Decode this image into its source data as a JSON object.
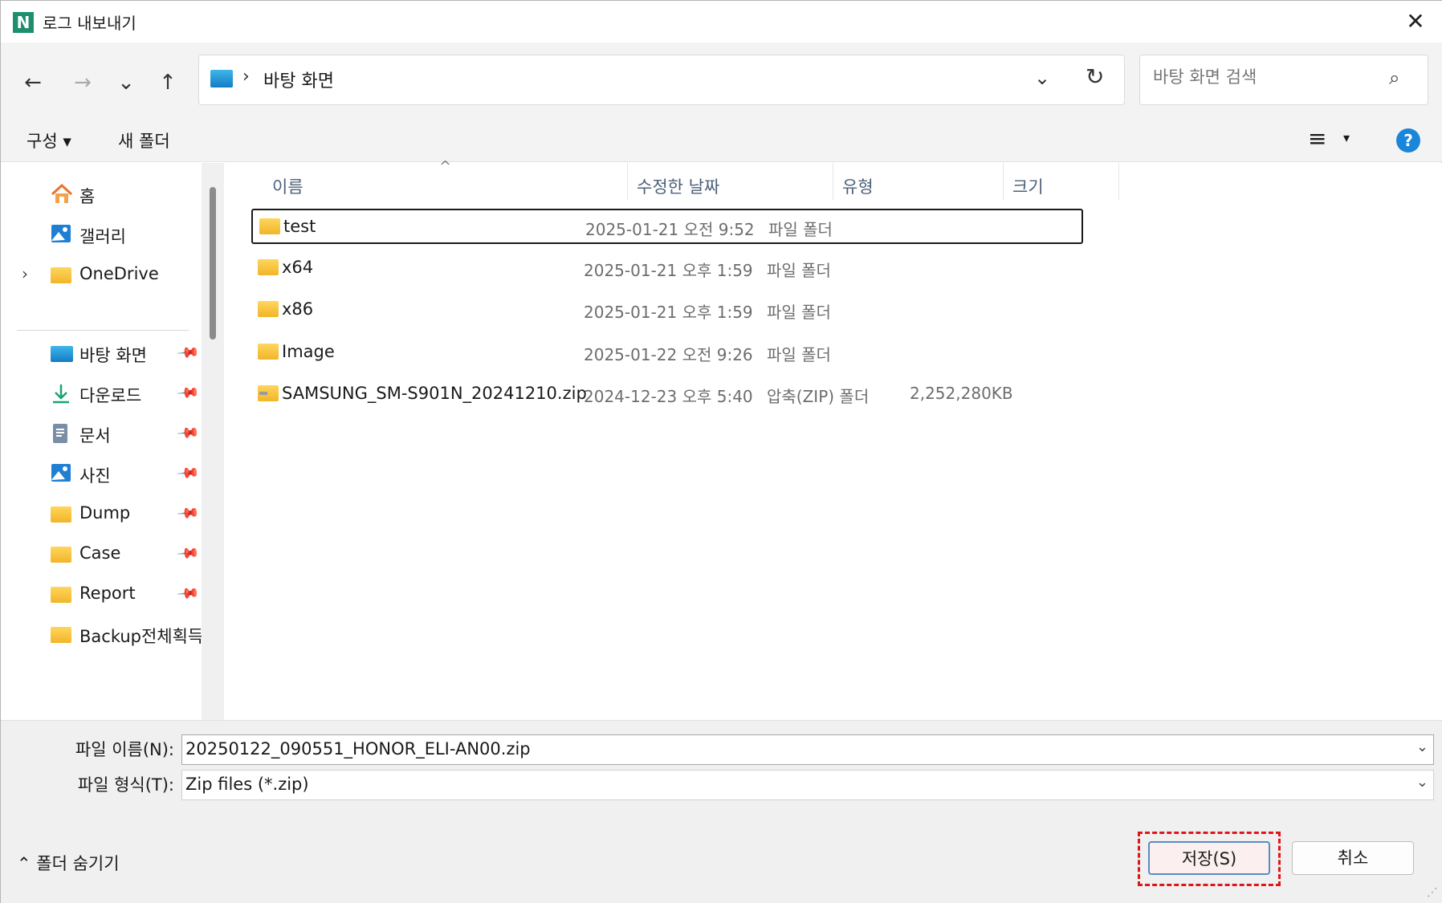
{
  "titlebar": {
    "app_icon_letter": "N",
    "title": "로그 내보내기",
    "close_glyph": "✕"
  },
  "nav": {
    "back_glyph": "←",
    "forward_glyph": "→",
    "recent_glyph": "⌄",
    "up_glyph": "↑",
    "address_separator": "›",
    "address_path": "바탕 화면",
    "address_dropdown_glyph": "⌄",
    "refresh_glyph": "↻",
    "search_placeholder": "바탕 화면 검색",
    "search_glyph": "⌕"
  },
  "commandbar": {
    "organize_label": "구성 ▾",
    "new_folder_label": "새 폴더",
    "view_glyph": "≡",
    "view_dropdown_glyph": "▾",
    "help_glyph": "?"
  },
  "sidebar": {
    "expander_glyph": "›",
    "pin_glyph": "📌",
    "top_items": [
      {
        "label": "홈",
        "icon": "home-icon"
      },
      {
        "label": "갤러리",
        "icon": "gallery-icon"
      },
      {
        "label": "OneDrive",
        "icon": "folder-icon"
      }
    ],
    "quick_items": [
      {
        "label": "바탕 화면",
        "icon": "desktop-icon",
        "pinned": true
      },
      {
        "label": "다운로드",
        "icon": "download-icon",
        "pinned": true
      },
      {
        "label": "문서",
        "icon": "document-icon",
        "pinned": true
      },
      {
        "label": "사진",
        "icon": "pictures-icon",
        "pinned": true
      },
      {
        "label": "Dump",
        "icon": "folder-icon",
        "pinned": true
      },
      {
        "label": "Case",
        "icon": "folder-icon",
        "pinned": true
      },
      {
        "label": "Report",
        "icon": "folder-icon",
        "pinned": true
      },
      {
        "label": "Backup전체획득",
        "icon": "folder-icon",
        "pinned": false
      }
    ]
  },
  "filelist": {
    "sort_glyph": "^",
    "columns": {
      "name": "이름",
      "date": "수정한 날짜",
      "type": "유형",
      "size": "크기"
    },
    "rows": [
      {
        "name": "test",
        "date": "2025-01-21 오전 9:52",
        "type": "파일 폴더",
        "size": "",
        "icon": "folder-icon",
        "selected": true
      },
      {
        "name": "x64",
        "date": "2025-01-21 오후 1:59",
        "type": "파일 폴더",
        "size": "",
        "icon": "folder-icon",
        "selected": false
      },
      {
        "name": "x86",
        "date": "2025-01-21 오후 1:59",
        "type": "파일 폴더",
        "size": "",
        "icon": "folder-icon",
        "selected": false
      },
      {
        "name": "Image",
        "date": "2025-01-22 오전 9:26",
        "type": "파일 폴더",
        "size": "",
        "icon": "folder-icon",
        "selected": false
      },
      {
        "name": "SAMSUNG_SM-S901N_20241210.zip",
        "date": "2024-12-23 오후 5:40",
        "type": "압축(ZIP) 폴더",
        "size": "2,252,280KB",
        "icon": "zip-folder-icon",
        "selected": false
      }
    ]
  },
  "bottom": {
    "filename_label": "파일 이름(N):",
    "filename_value": "20250122_090551_HONOR_ELI-AN00.zip",
    "filetype_label": "파일 형식(T):",
    "filetype_value": "Zip files (*.zip)",
    "dropdown_glyph": "⌄",
    "hide_folders_label": "⌃  폴더 숨기기",
    "save_label": "저장(S)",
    "cancel_label": "취소",
    "grip_glyph": "⋰"
  },
  "colors": {
    "accent": "#1a86d9",
    "highlight_dashed": "#e0151b",
    "folder_yellow": "#f1b52a",
    "app_icon_green": "#1d8f6e"
  }
}
